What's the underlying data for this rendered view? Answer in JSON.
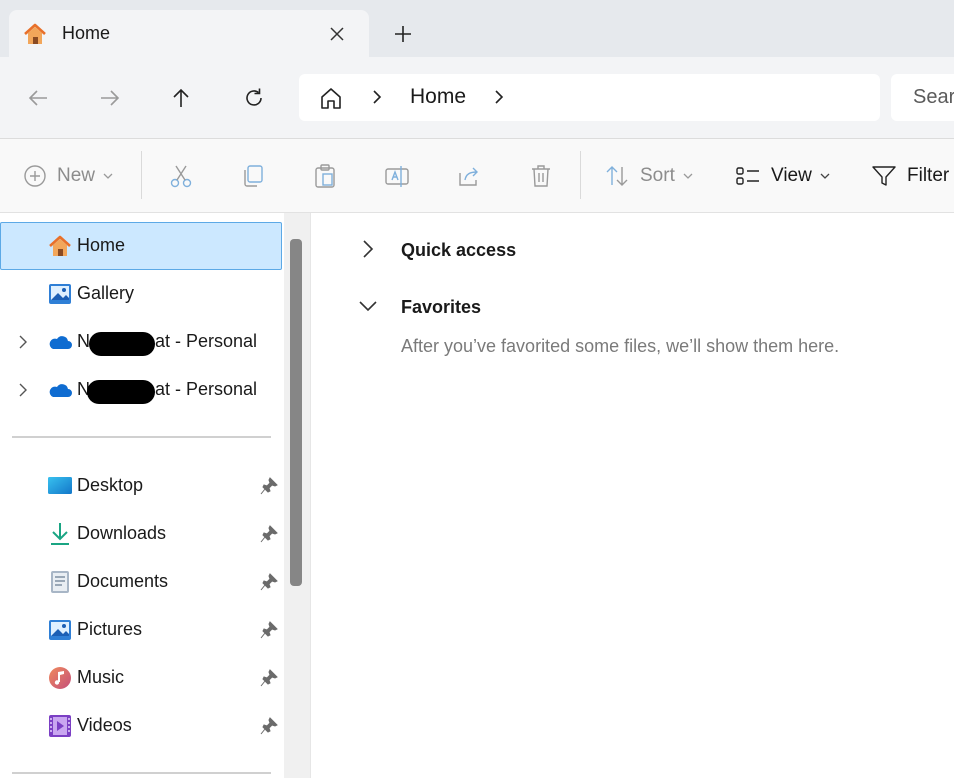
{
  "tab": {
    "title": "Home",
    "close_icon": "close-icon",
    "new_tab_icon": "plus-icon"
  },
  "nav": {
    "back_icon": "arrow-left-icon",
    "forward_icon": "arrow-right-icon",
    "up_icon": "arrow-up-icon",
    "refresh_icon": "refresh-icon"
  },
  "address": {
    "segment": "Home"
  },
  "search": {
    "placeholder": "Sear"
  },
  "commands": {
    "new": "New",
    "sort": "Sort",
    "view": "View",
    "filter": "Filter"
  },
  "sidebar": {
    "home": "Home",
    "gallery": "Gallery",
    "onedrive_1_prefix": "N",
    "onedrive_1_suffix": "at - Personal",
    "onedrive_2_prefix": "N",
    "onedrive_2_suffix": "at - Personal",
    "quick": [
      {
        "label": "Desktop",
        "icon": "desktop-icon"
      },
      {
        "label": "Downloads",
        "icon": "downloads-icon"
      },
      {
        "label": "Documents",
        "icon": "documents-icon"
      },
      {
        "label": "Pictures",
        "icon": "pictures-icon"
      },
      {
        "label": "Music",
        "icon": "music-icon"
      },
      {
        "label": "Videos",
        "icon": "videos-icon"
      }
    ]
  },
  "main": {
    "quick_access": "Quick access",
    "favorites": "Favorites",
    "favorites_empty": "After you’ve favorited some files, we’ll show them here."
  },
  "colors": {
    "selection_bg": "#cce8ff",
    "selection_border": "#5ca9e6",
    "accent_blue": "#0067c0"
  }
}
